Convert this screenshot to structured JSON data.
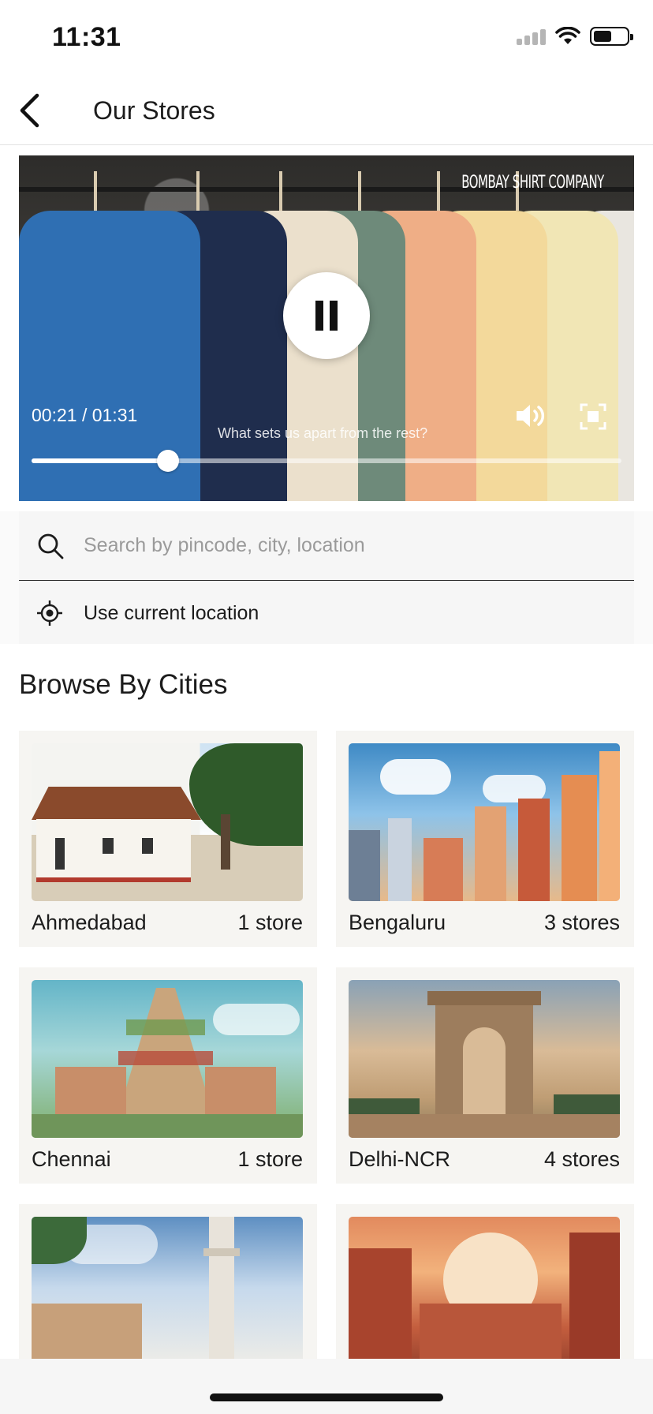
{
  "status_bar": {
    "time": "11:31"
  },
  "header": {
    "title": "Our Stores"
  },
  "video": {
    "brand": "BOMBAY SHIRT COMPANY",
    "time": "00:21 / 01:31",
    "caption": "What sets us apart from the rest?",
    "progress_fraction": 0.2308
  },
  "search": {
    "placeholder": "Search by pincode, city, location",
    "value": ""
  },
  "location": {
    "label": "Use current location"
  },
  "browse": {
    "title": "Browse By Cities",
    "cities": [
      {
        "name": "Ahmedabad",
        "count": "1 store"
      },
      {
        "name": "Bengaluru",
        "count": "3 stores"
      },
      {
        "name": "Chennai",
        "count": "1 store"
      },
      {
        "name": "Delhi-NCR",
        "count": "4 stores"
      },
      {
        "name": "",
        "count": ""
      },
      {
        "name": "",
        "count": ""
      }
    ]
  },
  "icons": {
    "back": "chevron-left-icon",
    "play_pause": "pause-icon",
    "volume": "volume-icon",
    "fullscreen": "fullscreen-icon",
    "search": "search-icon",
    "location": "crosshair-location-icon"
  }
}
